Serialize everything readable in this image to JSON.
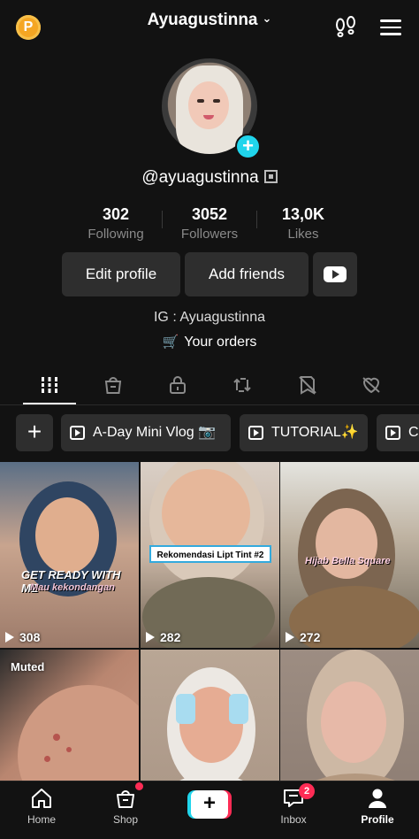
{
  "top_bar": {
    "coin_label": "P",
    "username": "Ayuagustinna",
    "chevron": "⌄"
  },
  "profile": {
    "handle": "@ayuagustinna",
    "stats": [
      {
        "value": "302",
        "label": "Following"
      },
      {
        "value": "3052",
        "label": "Followers"
      },
      {
        "value": "13,0K",
        "label": "Likes"
      }
    ],
    "buttons": {
      "edit_profile": "Edit profile",
      "add_friends": "Add friends"
    },
    "bio": "IG : Ayuagustinna",
    "orders": "Your orders"
  },
  "tabs": [
    "videos-grid",
    "shop",
    "private-lock",
    "reposts",
    "favorites",
    "liked"
  ],
  "playlists": {
    "add": "+",
    "items": [
      "A-Day Mini Vlog 📷",
      "TUTORIAL✨",
      "C"
    ]
  },
  "videos": [
    {
      "views": "308",
      "caption": "GET READY WITH ME",
      "sub": "Mau kekondangan"
    },
    {
      "views": "282",
      "caption": "Rekomendasi Lipt Tint #2"
    },
    {
      "views": "272",
      "caption": "Hijab Bella Square"
    },
    {
      "muted": "Muted"
    },
    {},
    {}
  ],
  "bottom_nav": {
    "home": "Home",
    "shop": "Shop",
    "create": "+",
    "inbox": "Inbox",
    "inbox_badge": "2",
    "profile": "Profile"
  },
  "colors": {
    "background": "#121212",
    "accent_pink": "#fe2c55",
    "accent_cyan": "#20d5ec",
    "coin": "#f5a623"
  }
}
